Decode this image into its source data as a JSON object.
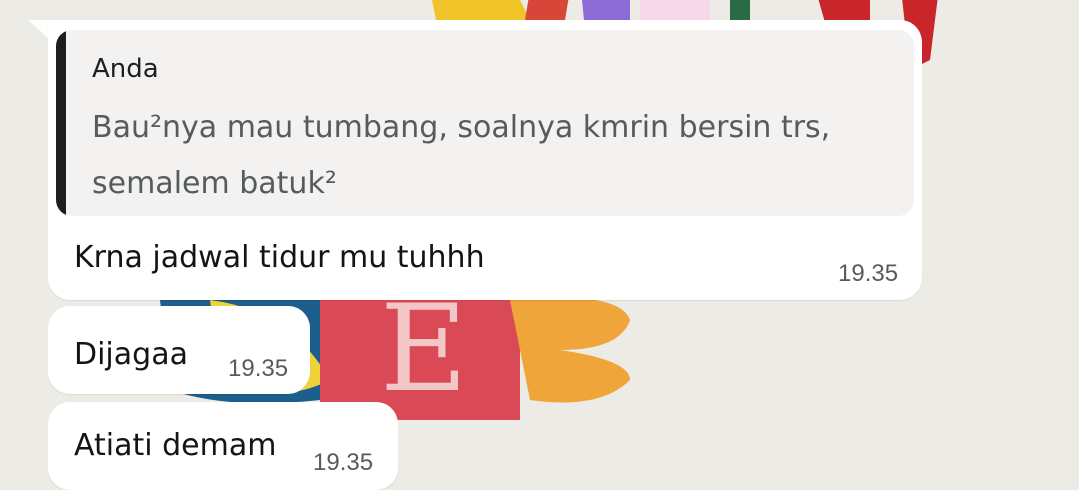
{
  "chat": {
    "reply": {
      "quoted_author": "Anda",
      "quoted_text_line1": "Bau²nya mau tumbang, soalnya kmrin bersin trs,",
      "quoted_text_line2": "semalem batuk²",
      "text": "Krna jadwal tidur mu tuhhh",
      "time": "19.35"
    },
    "messages": [
      {
        "text": "Dijagaa",
        "time": "19.35"
      },
      {
        "text": "Atiati demam",
        "time": "19.35"
      }
    ]
  },
  "colors": {
    "wallpaper": "#ecebe5",
    "bubble": "#ffffff",
    "quote_bg": "#f4f2f1",
    "quote_bar": "#1e1e1e",
    "quote_text": "#555c60",
    "time_text": "#555b60"
  }
}
